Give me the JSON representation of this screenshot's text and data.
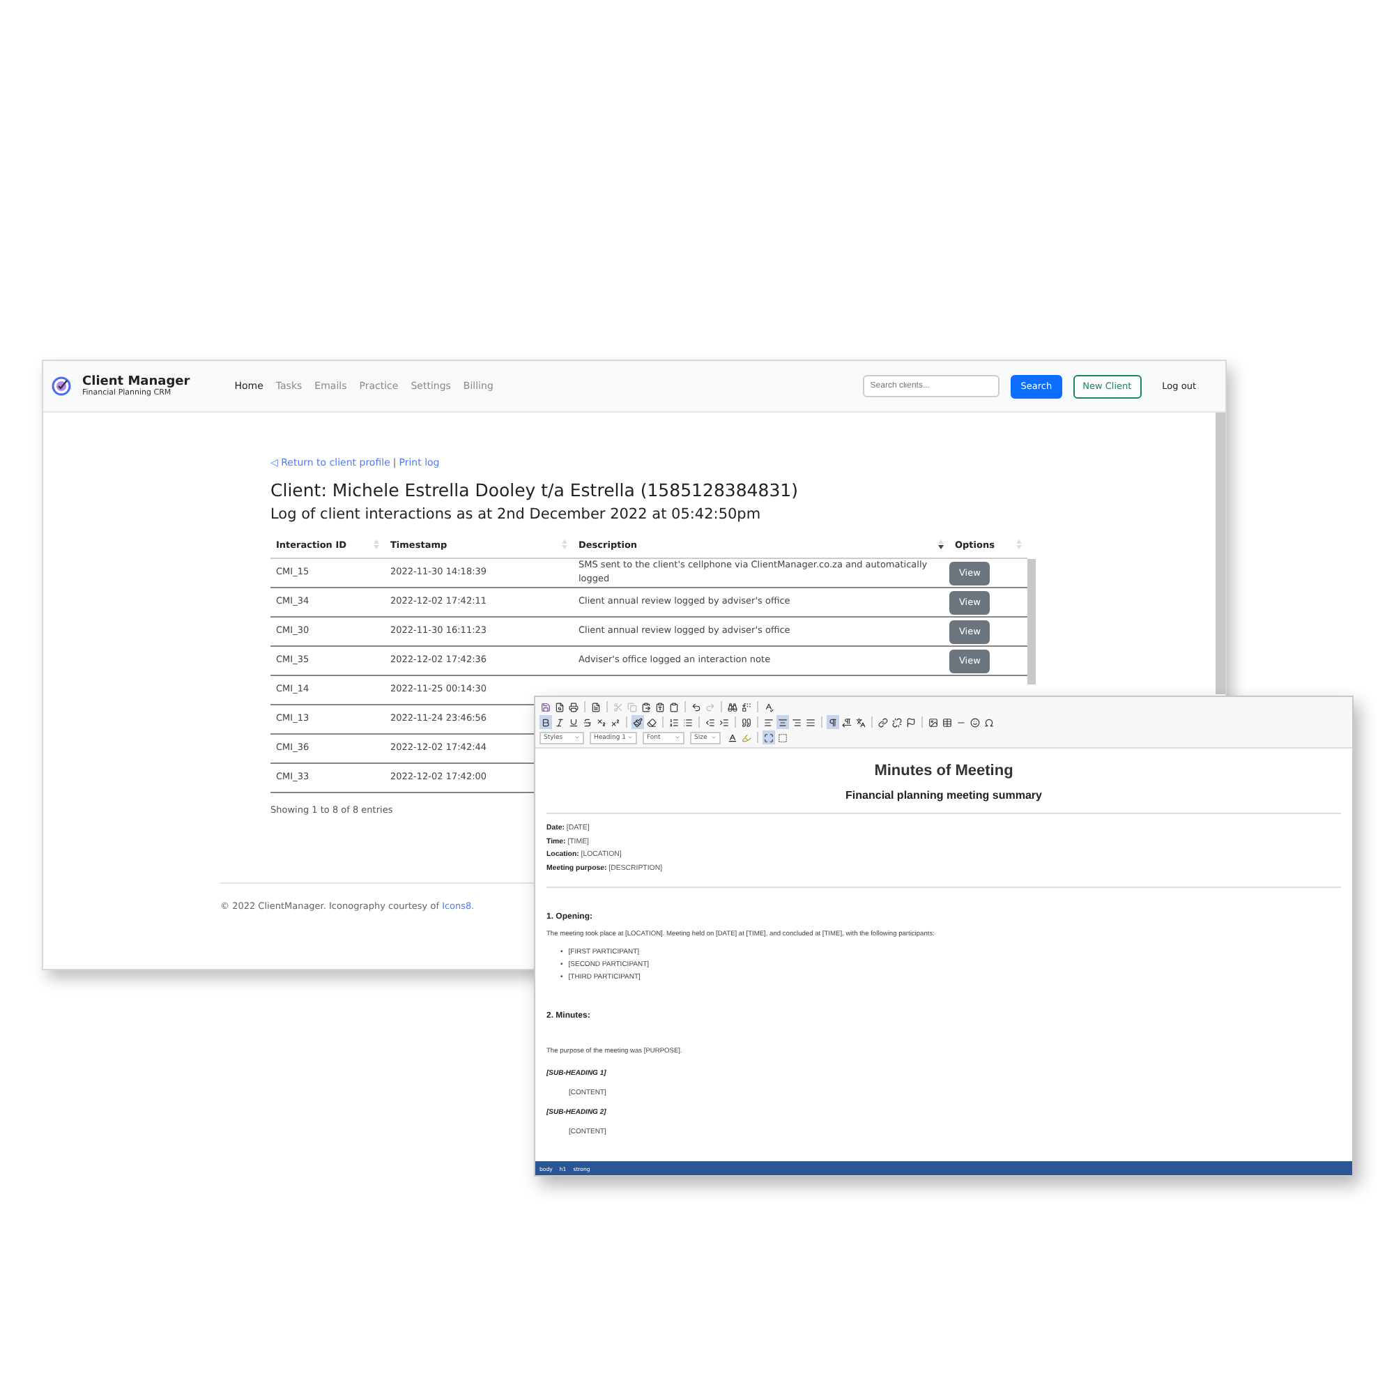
{
  "crm_window": {
    "brand": {
      "title": "Client Manager",
      "subtitle": "Financial Planning CRM"
    },
    "nav": [
      {
        "label": "Home",
        "selected": true
      },
      {
        "label": "Tasks",
        "selected": false
      },
      {
        "label": "Emails",
        "selected": false
      },
      {
        "label": "Practice",
        "selected": false
      },
      {
        "label": "Settings",
        "selected": false
      },
      {
        "label": "Billing",
        "selected": false
      }
    ],
    "search": {
      "placeholder": "Search clients...",
      "button": "Search"
    },
    "new_client": "New Client",
    "logout": "Log out",
    "links": [
      {
        "label": "◁ Return to client profile"
      },
      {
        "label": "Print log"
      }
    ],
    "link_separator": "|",
    "heading": "Client: Michele Estrella Dooley t/a Estrella (1585128384831)",
    "subheading": "Log of client interactions as at 2nd December 2022 at 05:42:50pm",
    "table": {
      "columns": [
        {
          "label": "Interaction ID",
          "sorted": false
        },
        {
          "label": "Timestamp",
          "sorted": false
        },
        {
          "label": "Description",
          "sorted": true
        },
        {
          "label": "Options",
          "sorted": false
        }
      ],
      "rows": [
        {
          "id": "CMI_15",
          "timestamp": "2022-11-30 14:18:39",
          "description": "SMS sent to the client's cellphone via ClientManager.co.za and automatically logged",
          "option": "View"
        },
        {
          "id": "CMI_34",
          "timestamp": "2022-12-02 17:42:11",
          "description": "Client annual review logged by adviser's office",
          "option": "View"
        },
        {
          "id": "CMI_30",
          "timestamp": "2022-11-30 16:11:23",
          "description": "Client annual review logged by adviser's office",
          "option": "View"
        },
        {
          "id": "CMI_35",
          "timestamp": "2022-12-02 17:42:36",
          "description": "Adviser's office logged an interaction note",
          "option": "View"
        },
        {
          "id": "CMI_14",
          "timestamp": "2022-11-25 00:14:30"
        },
        {
          "id": "CMI_13",
          "timestamp": "2022-11-24 23:46:56"
        },
        {
          "id": "CMI_36",
          "timestamp": "2022-12-02 17:42:44"
        },
        {
          "id": "CMI_33",
          "timestamp": "2022-12-02 17:42:00"
        }
      ],
      "info": "Showing 1 to 8 of 8 entries"
    },
    "footer": {
      "text": "© 2022 ClientManager. Iconography courtesy of",
      "link": "Icons8."
    }
  },
  "editor_window": {
    "format_buttons": [
      {
        "active": true
      },
      {
        "active": false
      },
      {
        "active": false
      },
      {
        "active": false
      },
      {
        "active": false
      },
      {
        "active": false
      },
      {
        "active": true
      },
      {
        "active": false
      },
      {
        "active": false
      },
      {
        "active": false
      },
      {
        "active": false
      },
      {
        "active": false
      },
      {
        "active": false
      },
      {
        "active": false
      },
      {
        "active": true
      },
      {
        "active": false
      },
      {
        "active": false
      },
      {
        "active": true
      },
      {
        "active": false
      },
      {
        "active": false
      },
      {
        "active": false
      },
      {
        "active": false
      },
      {
        "active": false
      },
      {
        "active": false
      },
      {
        "active": false
      },
      {
        "active": false
      },
      {
        "active": false
      },
      {
        "active": false
      }
    ],
    "dropdowns": [
      "Styles",
      "Heading 1",
      "Font",
      "Size"
    ],
    "document": {
      "title": "Minutes of Meeting",
      "subtitle": "Financial planning meeting summary",
      "fields": [
        "**Date:** [DATE]",
        "**Time:** [TIME]",
        "**Location:** [LOCATION]",
        "**Meeting purpose:** [DESCRIPTION]"
      ],
      "sections": [
        {
          "heading": "1. Opening:",
          "blocks": [
            {
              "kind": "paragraph",
              "text": "The meeting took place at [LOCATION]. Meeting held on [DATE] at [TIME], and concluded at [TIME], with the following participants:"
            },
            {
              "kind": "list",
              "marker": "•",
              "items": [
                "[FIRST PARTICIPANT]",
                "[SECOND PARTICIPANT]",
                "[THIRD PARTICIPANT]"
              ]
            }
          ]
        },
        {
          "heading": "2. Minutes:",
          "blocks": [
            {
              "kind": "paragraph",
              "text": "The purpose of the meeting was [PURPOSE]."
            },
            {
              "kind": "subheading",
              "text": "[SUB-HEADING 1]"
            },
            {
              "kind": "indent",
              "text": "[CONTENT]"
            },
            {
              "kind": "subheading",
              "text": "[SUB-HEADING 2]"
            },
            {
              "kind": "indent",
              "text": "[CONTENT]"
            }
          ]
        }
      ]
    },
    "status_path": [
      "body",
      "h1",
      "strong"
    ]
  }
}
